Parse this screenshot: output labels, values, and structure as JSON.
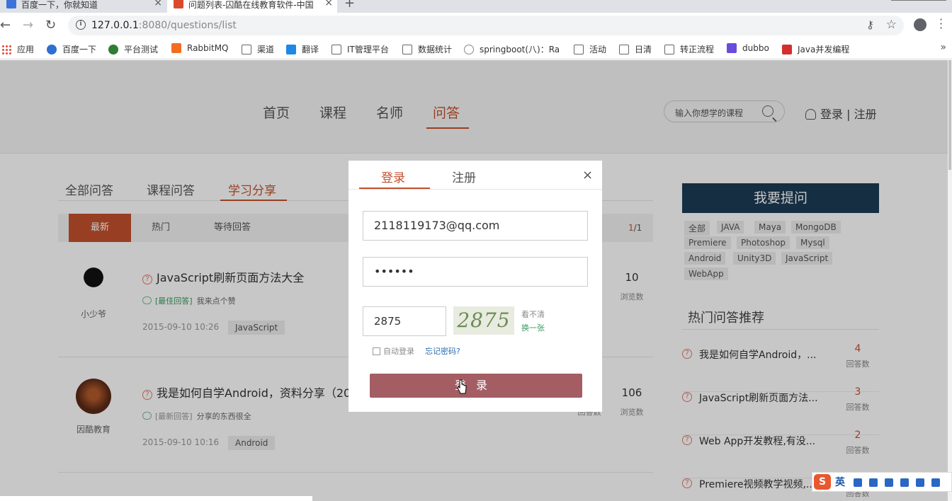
{
  "browser": {
    "tabs": [
      {
        "title": "百度一下，你就知道"
      },
      {
        "title": "问题列表-囚酷在线教育软件-中国"
      }
    ],
    "url_host": "127.0.0.1",
    "url_rest": ":8080/questions/list",
    "bookmarks": [
      "应用",
      "百度一下",
      "平台测试",
      "RabbitMQ",
      "渠道",
      "翻译",
      "IT管理平台",
      "数据统计",
      "springboot(八)：Ra",
      "活动",
      "日清",
      "转正流程",
      "dubbo",
      "Java并发编程"
    ]
  },
  "site": {
    "nav": [
      "首页",
      "课程",
      "名师",
      "问答"
    ],
    "search_placeholder": "输入你想学的课程",
    "login": "登录",
    "separator": "|",
    "register": "注册"
  },
  "qa": {
    "tabs": [
      "全部问答",
      "课程问答",
      "学习分享"
    ],
    "filters": [
      "最新",
      "热门",
      "等待回答"
    ],
    "pager_current": "1",
    "pager_total": "/1",
    "questions": [
      {
        "user": "小少爷",
        "title": "JavaScript刷新页面方法大全",
        "answer_tag": "[最佳回答]",
        "answer": "我来点个赞",
        "date": "2015-09-10 10:26",
        "tag": "JavaScript",
        "count": "10",
        "count_label": "浏览数",
        "count2_label": ""
      },
      {
        "user": "因酷教育",
        "title": "我是如何自学Android，资料分享（20",
        "answer_tag": "[最新回答]",
        "answer": "分享的东西很全",
        "date": "2015-09-10 10:16",
        "tag": "Android",
        "count": "106",
        "count_label": "浏览数",
        "count2_label": "回答数"
      }
    ]
  },
  "sidebar": {
    "ask_button": "我要提问",
    "tags": [
      "全部",
      "JAVA",
      "Maya",
      "MongoDB",
      "Premiere",
      "Photoshop",
      "Mysql",
      "Android",
      "Unity3D",
      "JavaScript",
      "WebApp"
    ],
    "hot_title": "热门问答推荐",
    "hot": [
      {
        "title": "我是如何自学Android，...",
        "count": "4",
        "label": "回答数"
      },
      {
        "title": "JavaScript刷新页面方法...",
        "count": "3",
        "label": "回答数"
      },
      {
        "title": "Web App开发教程,有没...",
        "count": "2",
        "label": "回答数"
      },
      {
        "title": "Premiere视频教学视频,...",
        "count": "",
        "label": "回答数"
      }
    ]
  },
  "modal": {
    "tab_login": "登录",
    "tab_register": "注册",
    "close": "×",
    "email": "2118119173@qq.com",
    "password": "••••••",
    "captcha_input": "2875",
    "captcha_image": "2875",
    "captcha_unclear": "看不清",
    "captcha_refresh": "换一张",
    "auto_login": "自动登录",
    "forgot": "忘记密码?",
    "submit": "登录"
  },
  "ime": {
    "lang": "英"
  },
  "colors": {
    "accent": "#c3512d",
    "ask_bg": "#1d3b55",
    "login_btn": "#a45d63"
  }
}
